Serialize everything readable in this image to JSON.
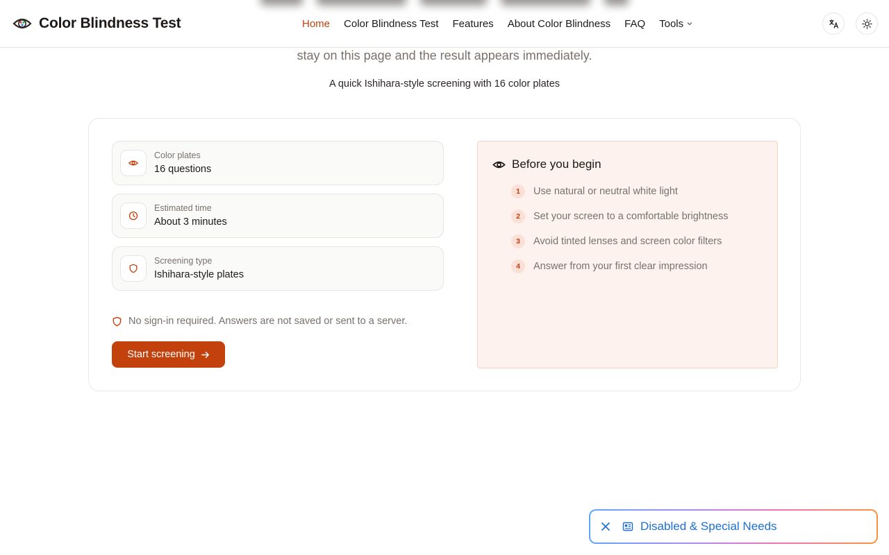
{
  "header": {
    "brand": "Color Blindness Test",
    "nav": [
      {
        "label": "Home",
        "active": true
      },
      {
        "label": "Color Blindness Test",
        "active": false
      },
      {
        "label": "Features",
        "active": false
      },
      {
        "label": "About Color Blindness",
        "active": false
      },
      {
        "label": "FAQ",
        "active": false
      },
      {
        "label": "Tools",
        "active": false,
        "has_dropdown": true
      }
    ],
    "icons": {
      "language": "translate-icon",
      "theme": "sun-icon"
    }
  },
  "intro": {
    "line": "stay on this page and the result appears immediately.",
    "subtitle": "A quick Ishihara-style screening with 16 color plates"
  },
  "info": [
    {
      "label": "Color plates",
      "value": "16 questions",
      "icon": "eye-icon"
    },
    {
      "label": "Estimated time",
      "value": "About 3 minutes",
      "icon": "clock-icon"
    },
    {
      "label": "Screening type",
      "value": "Ishihara-style plates",
      "icon": "shield-icon"
    }
  ],
  "privacy": "No sign-in required. Answers are not saved or sent to a server.",
  "start_button": "Start screening",
  "before": {
    "title": "Before you begin",
    "steps": [
      {
        "num": "1",
        "text": "Use natural or neutral white light"
      },
      {
        "num": "2",
        "text": "Set your screen to a comfortable brightness"
      },
      {
        "num": "3",
        "text": "Avoid tinted lenses and screen color filters"
      },
      {
        "num": "4",
        "text": "Answer from your first clear impression"
      }
    ]
  },
  "banner": {
    "text": "Disabled & Special Needs"
  },
  "colors": {
    "accent": "#c2410c",
    "panel_bg": "#fdf2ee",
    "banner_text": "#1d6fd6"
  }
}
